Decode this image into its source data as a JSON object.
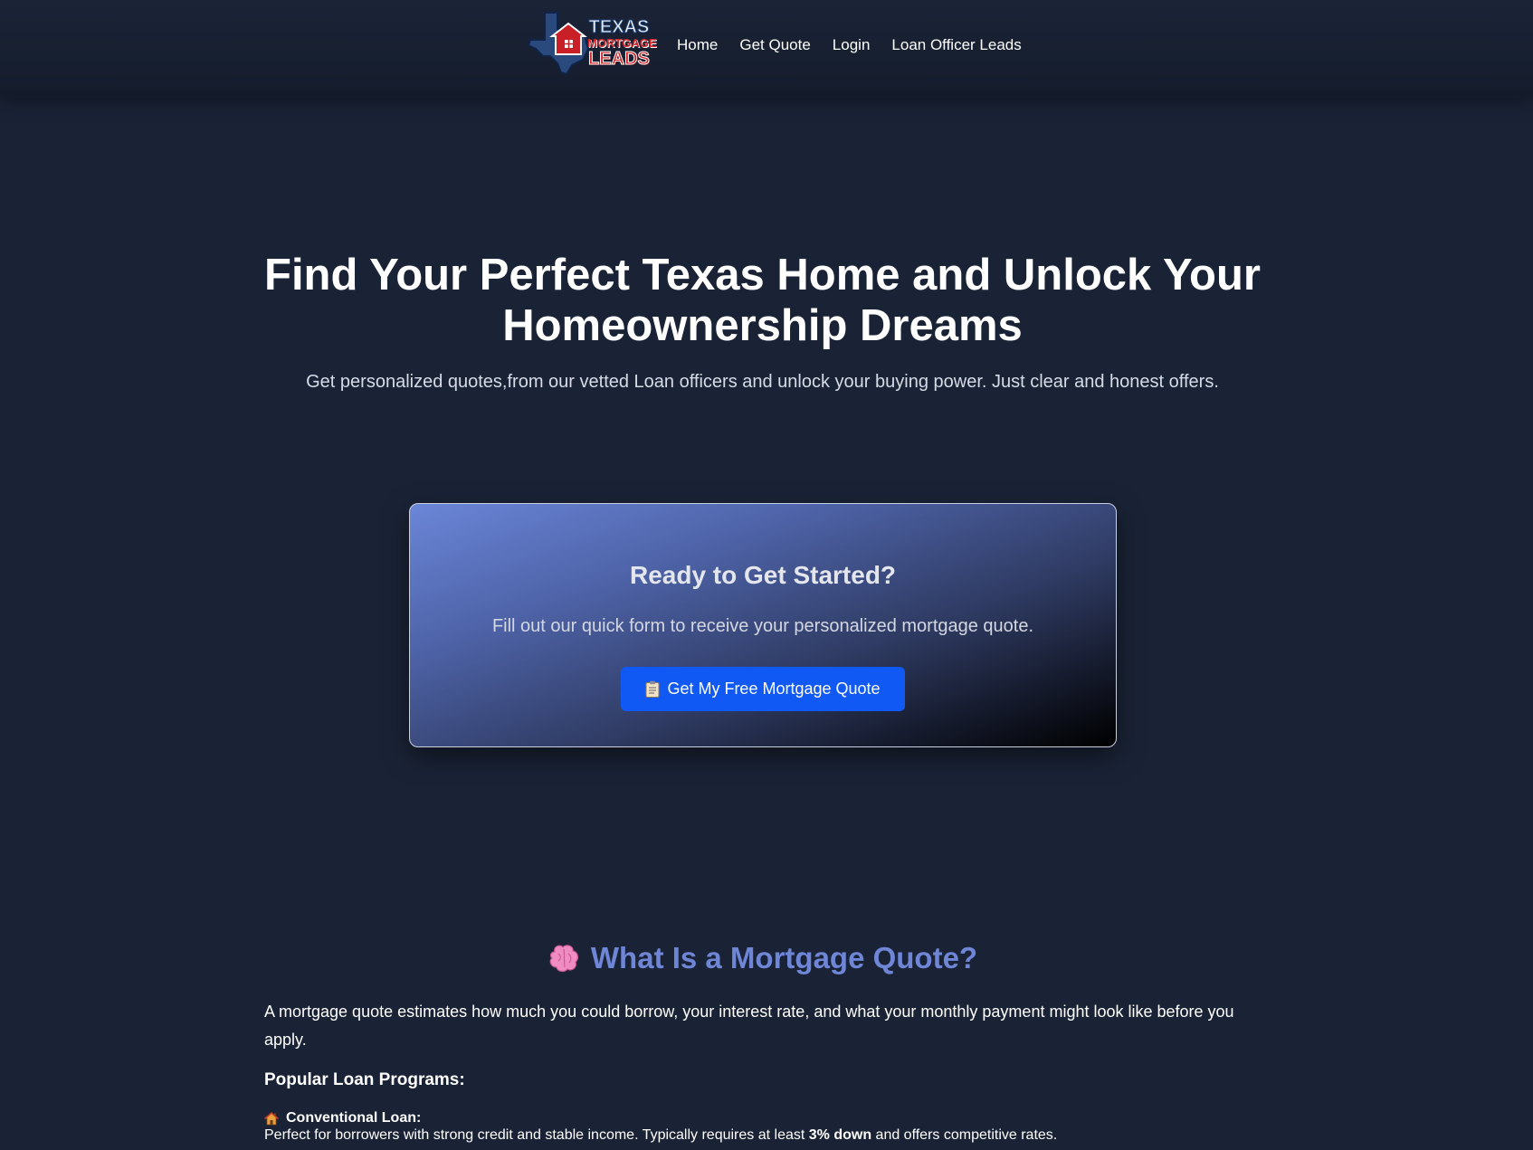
{
  "header": {
    "logo": {
      "line1": "TEXAS",
      "line2": "MORTGAGE",
      "line3": "LEADS"
    },
    "nav": [
      {
        "label": "Home"
      },
      {
        "label": "Get Quote"
      },
      {
        "label": "Login"
      },
      {
        "label": "Loan Officer Leads"
      }
    ]
  },
  "hero": {
    "title": "Find Your Perfect Texas Home and Unlock Your Homeownership Dreams",
    "subtitle": "Get personalized quotes,from our vetted Loan officers and unlock your buying power. Just clear and honest offers."
  },
  "cta": {
    "heading": "Ready to Get Started?",
    "text": "Fill out our quick form to receive your personalized mortgage quote.",
    "button_label": "Get My Free Mortgage Quote",
    "button_icon": "clipboard-icon"
  },
  "info": {
    "title": "What Is a Mortgage Quote?",
    "title_icon": "brain-icon",
    "body": "A mortgage quote estimates how much you could borrow, your interest rate, and what your monthly payment might look like before you apply.",
    "programs_title": "Popular Loan Programs:",
    "programs": [
      {
        "icon": "house-icon",
        "name": "Conventional Loan:",
        "desc_before": "Perfect for borrowers with strong credit and stable income. Typically requires at least ",
        "desc_bold": "3% down",
        "desc_after": " and offers competitive rates."
      }
    ]
  },
  "colors": {
    "background": "#1a2336",
    "accent": "#6f86d6",
    "button": "#1159f5"
  }
}
